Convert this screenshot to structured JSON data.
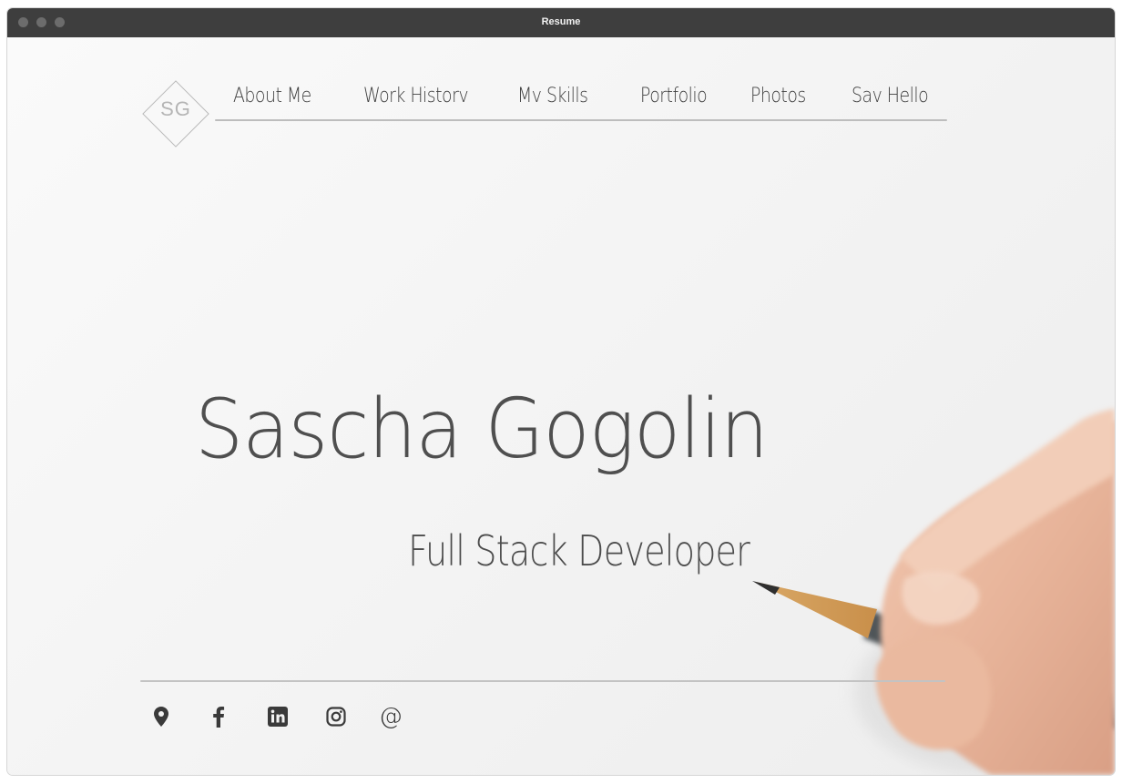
{
  "window": {
    "title": "Resume"
  },
  "logo": {
    "initials": "SG"
  },
  "nav": {
    "items": [
      {
        "label": "About Me"
      },
      {
        "label": "Work Historv"
      },
      {
        "label": "Mv Skills"
      },
      {
        "label": "Portfolio"
      },
      {
        "label": "Photos"
      },
      {
        "label": "Sav Hello"
      }
    ]
  },
  "hero": {
    "name": "Sascha Gogolin",
    "role": "Full Stack Developer"
  },
  "social": [
    {
      "icon": "map-pin-icon"
    },
    {
      "icon": "facebook-icon"
    },
    {
      "icon": "linkedin-icon"
    },
    {
      "icon": "instagram-icon"
    },
    {
      "icon": "email-at-icon",
      "glyph": "@"
    }
  ],
  "colors": {
    "text": "#4f4f4f",
    "line": "#bdbdbd",
    "titlebar": "#3e3e3e"
  }
}
